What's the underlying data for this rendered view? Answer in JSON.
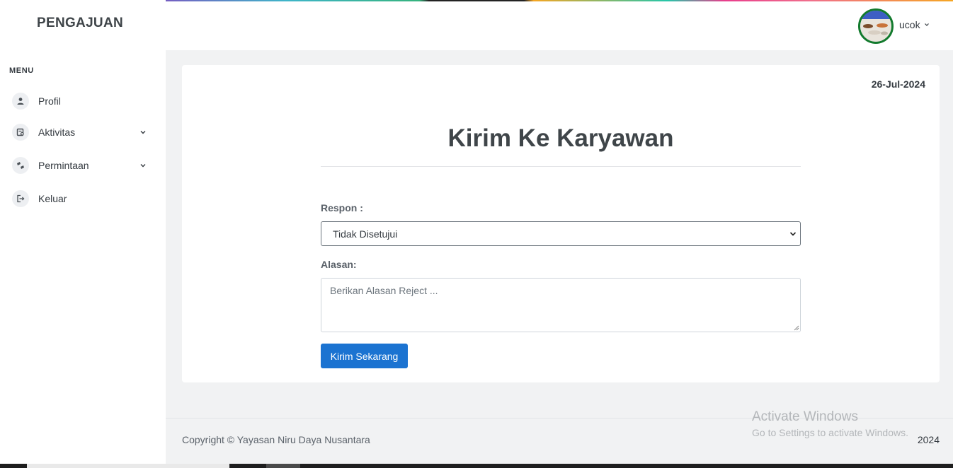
{
  "sidebar": {
    "brand": "PENGAJUAN",
    "menu_title": "MENU",
    "items": [
      {
        "label": "Profil",
        "icon": "user-icon"
      },
      {
        "label": "Aktivitas",
        "icon": "activity-list-icon"
      },
      {
        "label": "Permintaan",
        "icon": "request-icon"
      },
      {
        "label": "Keluar",
        "icon": "logout-icon"
      }
    ]
  },
  "header": {
    "username": "ucok"
  },
  "card": {
    "date": "26-Jul-2024",
    "title": "Kirim Ke Karyawan",
    "respon_label": "Respon :",
    "respon_value": "Tidak Disetujui",
    "alasan_label": "Alasan:",
    "alasan_placeholder": "Berikan Alasan Reject ...",
    "submit_label": "Kirim Sekarang"
  },
  "footer": {
    "copyright": "Copyright © Yayasan Niru Daya Nusantara",
    "year": "2024"
  },
  "watermark": {
    "line1": "Activate Windows",
    "line2": "Go to Settings to activate Windows."
  },
  "colors": {
    "primary": "#1b73d1",
    "avatar_border": "#127a2d"
  }
}
